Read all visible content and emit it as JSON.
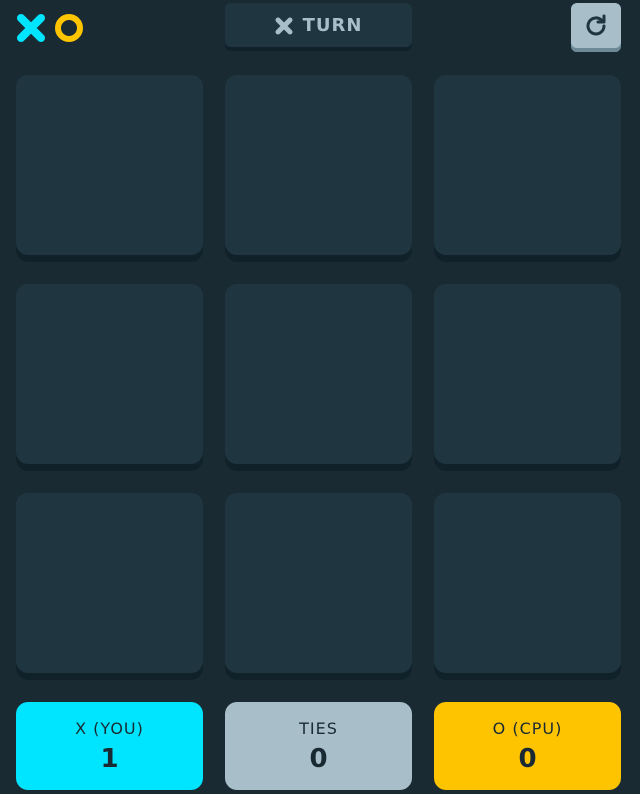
{
  "header": {
    "logo_icons": [
      "x-icon",
      "o-icon"
    ],
    "turn": {
      "mark_icon": "x-icon",
      "label": "TURN"
    },
    "restart_icon": "restart-icon"
  },
  "board": {
    "cells": [
      "",
      "",
      "",
      "",
      "",
      "",
      "",
      "",
      ""
    ]
  },
  "scores": {
    "x": {
      "label": "X (YOU)",
      "value": "1"
    },
    "ties": {
      "label": "TIES",
      "value": "0"
    },
    "o": {
      "label": "O (CPU)",
      "value": "0"
    }
  },
  "colors": {
    "background": "#1a2a33",
    "tile": "#1f3641",
    "x_accent": "#00e5ff",
    "o_accent": "#ffc400",
    "silver": "#a8bfc9"
  }
}
